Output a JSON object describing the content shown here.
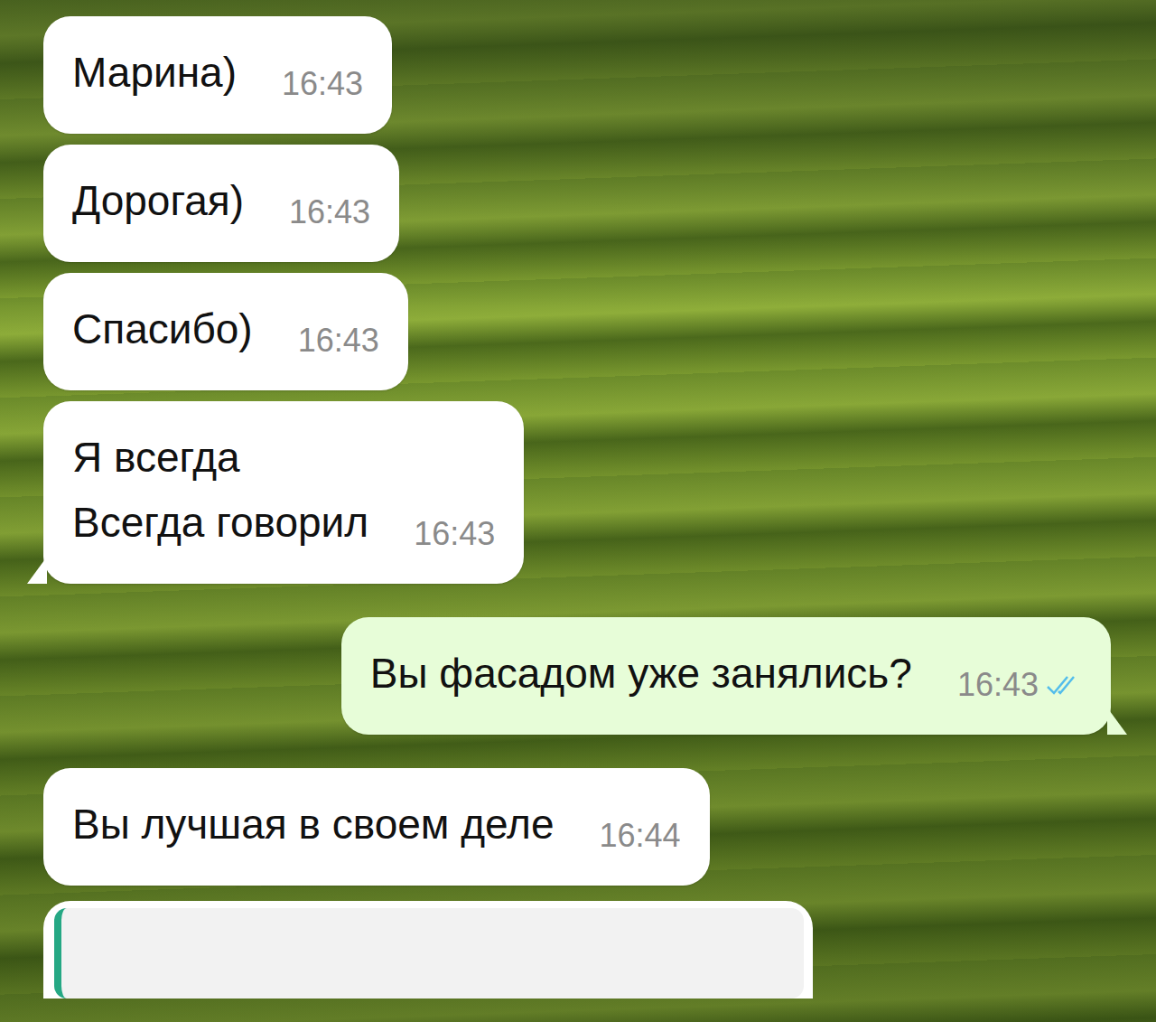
{
  "chat": {
    "messages": [
      {
        "kind": "text",
        "direction": "incoming",
        "text": "Марина)",
        "time": "16:43",
        "tail": false
      },
      {
        "kind": "text",
        "direction": "incoming",
        "text": "Дорогая)",
        "time": "16:43",
        "tail": false
      },
      {
        "kind": "text",
        "direction": "incoming",
        "text": "Спасибо)",
        "time": "16:43",
        "tail": false
      },
      {
        "kind": "text",
        "direction": "incoming",
        "text": "Я всегда\nВсегда говорил",
        "time": "16:43",
        "tail": true
      },
      {
        "kind": "text",
        "direction": "outgoing",
        "text": "Вы фасадом уже занялись?",
        "time": "16:43",
        "tail": true,
        "read": true
      },
      {
        "kind": "text",
        "direction": "incoming",
        "text": "Вы лучшая в своем деле",
        "time": "16:44",
        "tail": false
      },
      {
        "kind": "quote",
        "direction": "incoming",
        "tail": false
      }
    ]
  }
}
